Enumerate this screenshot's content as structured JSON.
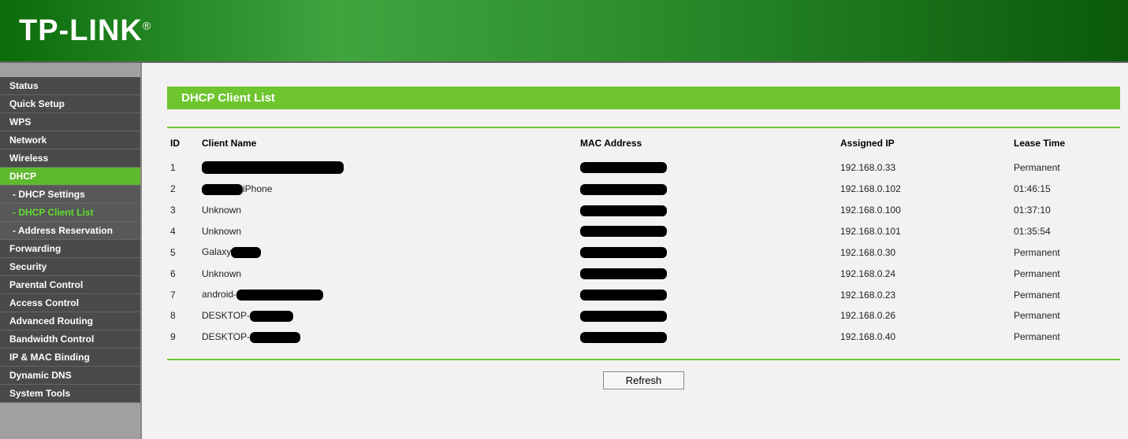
{
  "brand": "TP-LINK",
  "sidebar": {
    "items": [
      {
        "label": "Status",
        "kind": "top",
        "active": false
      },
      {
        "label": "Quick Setup",
        "kind": "top",
        "active": false
      },
      {
        "label": "WPS",
        "kind": "top",
        "active": false
      },
      {
        "label": "Network",
        "kind": "top",
        "active": false
      },
      {
        "label": "Wireless",
        "kind": "top",
        "active": false
      },
      {
        "label": "DHCP",
        "kind": "top",
        "active": true
      },
      {
        "label": "- DHCP Settings",
        "kind": "sub",
        "active": false
      },
      {
        "label": "- DHCP Client List",
        "kind": "sub",
        "active": true
      },
      {
        "label": "- Address Reservation",
        "kind": "sub",
        "active": false
      },
      {
        "label": "Forwarding",
        "kind": "top",
        "active": false
      },
      {
        "label": "Security",
        "kind": "top",
        "active": false
      },
      {
        "label": "Parental Control",
        "kind": "top",
        "active": false
      },
      {
        "label": "Access Control",
        "kind": "top",
        "active": false
      },
      {
        "label": "Advanced Routing",
        "kind": "top",
        "active": false
      },
      {
        "label": "Bandwidth Control",
        "kind": "top",
        "active": false
      },
      {
        "label": "IP & MAC Binding",
        "kind": "top",
        "active": false
      },
      {
        "label": "Dynamic DNS",
        "kind": "top",
        "active": false
      },
      {
        "label": "System Tools",
        "kind": "top",
        "active": false
      }
    ]
  },
  "panel": {
    "title": "DHCP Client List",
    "columns": {
      "id": "ID",
      "name": "Client Name",
      "mac": "MAC Address",
      "ip": "Assigned IP",
      "lease": "Lease Time"
    },
    "refresh_label": "Refresh"
  },
  "clients": [
    {
      "id": "1",
      "name_prefix": "",
      "name_suffix": "",
      "name_style": "full",
      "ip": "192.168.0.33",
      "lease": "Permanent"
    },
    {
      "id": "2",
      "name_prefix": "",
      "name_suffix": "iPhone",
      "name_style": "pre",
      "ip": "192.168.0.102",
      "lease": "01:46:15"
    },
    {
      "id": "3",
      "name_prefix": "Unknown",
      "name_suffix": "",
      "name_style": "none",
      "ip": "192.168.0.100",
      "lease": "01:37:10"
    },
    {
      "id": "4",
      "name_prefix": "Unknown",
      "name_suffix": "",
      "name_style": "none",
      "ip": "192.168.0.101",
      "lease": "01:35:54"
    },
    {
      "id": "5",
      "name_prefix": "Galaxy",
      "name_suffix": "",
      "name_style": "suf",
      "ip": "192.168.0.30",
      "lease": "Permanent"
    },
    {
      "id": "6",
      "name_prefix": "Unknown",
      "name_suffix": "",
      "name_style": "none",
      "ip": "192.168.0.24",
      "lease": "Permanent"
    },
    {
      "id": "7",
      "name_prefix": "android-",
      "name_suffix": "",
      "name_style": "and",
      "ip": "192.168.0.23",
      "lease": "Permanent"
    },
    {
      "id": "8",
      "name_prefix": "DESKTOP-",
      "name_suffix": "",
      "name_style": "desk",
      "ip": "192.168.0.26",
      "lease": "Permanent"
    },
    {
      "id": "9",
      "name_prefix": "DESKTOP-",
      "name_suffix": "",
      "name_style": "desk2",
      "ip": "192.168.0.40",
      "lease": "Permanent"
    }
  ]
}
